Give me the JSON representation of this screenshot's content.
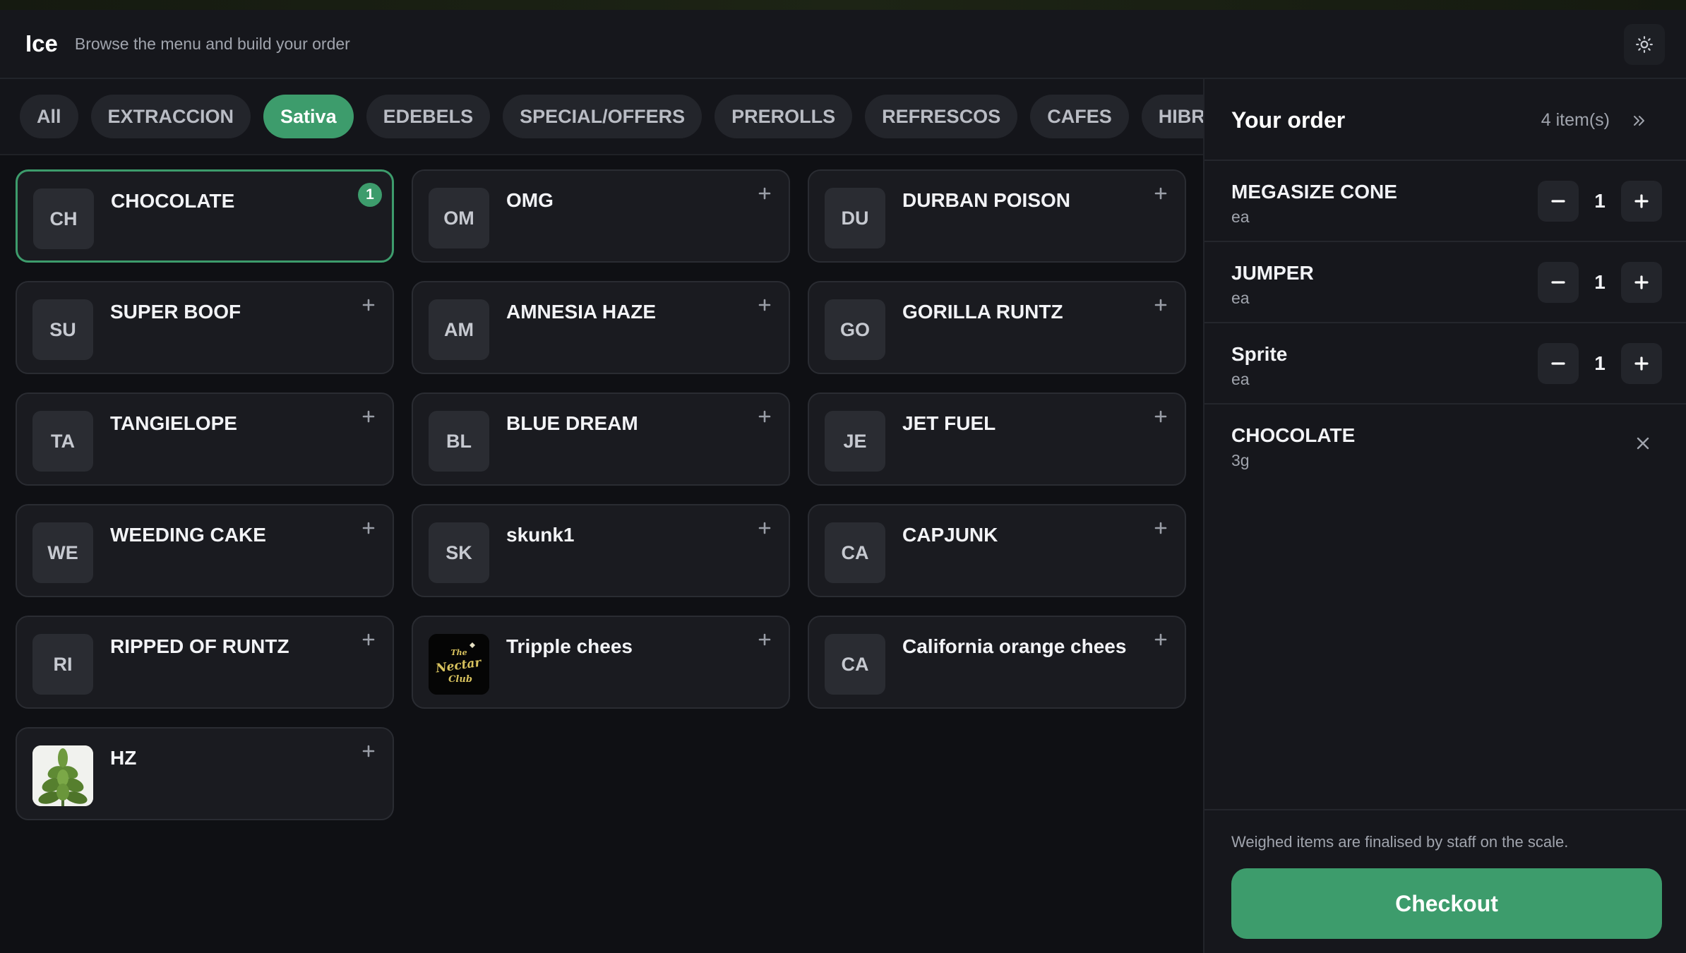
{
  "app": {
    "title": "Ice",
    "subtitle": "Browse the menu and build your order",
    "accent_color": "#3d9c6c",
    "theme_icon": "sun-icon"
  },
  "tabs": [
    {
      "label": "All",
      "active": false
    },
    {
      "label": "EXTRACCION",
      "active": false
    },
    {
      "label": "Sativa",
      "active": true
    },
    {
      "label": "EDEBELS",
      "active": false
    },
    {
      "label": "SPECIAL/OFFERS",
      "active": false
    },
    {
      "label": "PREROLLS",
      "active": false
    },
    {
      "label": "REFRESCOS",
      "active": false
    },
    {
      "label": "CAFES",
      "active": false
    },
    {
      "label": "HIBRIDA",
      "active": false
    }
  ],
  "products": [
    {
      "initials": "CH",
      "name": "CHOCOLATE",
      "selected": true,
      "quantity": "1"
    },
    {
      "initials": "OM",
      "name": "OMG"
    },
    {
      "initials": "DU",
      "name": "DURBAN POISON"
    },
    {
      "initials": "SU",
      "name": "SUPER BOOF"
    },
    {
      "initials": "AM",
      "name": "AMNESIA HAZE"
    },
    {
      "initials": "GO",
      "name": "GORILLA RUNTZ"
    },
    {
      "initials": "TA",
      "name": "TANGIELOPE"
    },
    {
      "initials": "BL",
      "name": "BLUE DREAM"
    },
    {
      "initials": "JE",
      "name": "JET FUEL"
    },
    {
      "initials": "WE",
      "name": "WEEDING CAKE"
    },
    {
      "initials": "SK",
      "name": "skunk1"
    },
    {
      "initials": "CA",
      "name": "CAPJUNK"
    },
    {
      "initials": "RI",
      "name": "RIPPED OF RUNTZ"
    },
    {
      "initials": "",
      "name": "Tripple chees",
      "image": "nectar-club-logo",
      "logo_text": "The Nectar Club"
    },
    {
      "initials": "CA",
      "name": "California orange chees"
    },
    {
      "initials": "",
      "name": "HZ",
      "image": "cannabis-plant-photo"
    }
  ],
  "order": {
    "title": "Your order",
    "count": "4 item(s)",
    "items": [
      {
        "name": "MEGASIZE CONE",
        "unit": "ea",
        "quantity": "1",
        "type": "stepper"
      },
      {
        "name": "JUMPER",
        "unit": "ea",
        "quantity": "1",
        "type": "stepper"
      },
      {
        "name": "Sprite",
        "unit": "ea",
        "quantity": "1",
        "type": "stepper"
      },
      {
        "name": "CHOCOLATE",
        "unit": "3g",
        "type": "weighed"
      }
    ],
    "note": "Weighed items are finalised by staff on the scale.",
    "checkout_label": "Checkout"
  }
}
